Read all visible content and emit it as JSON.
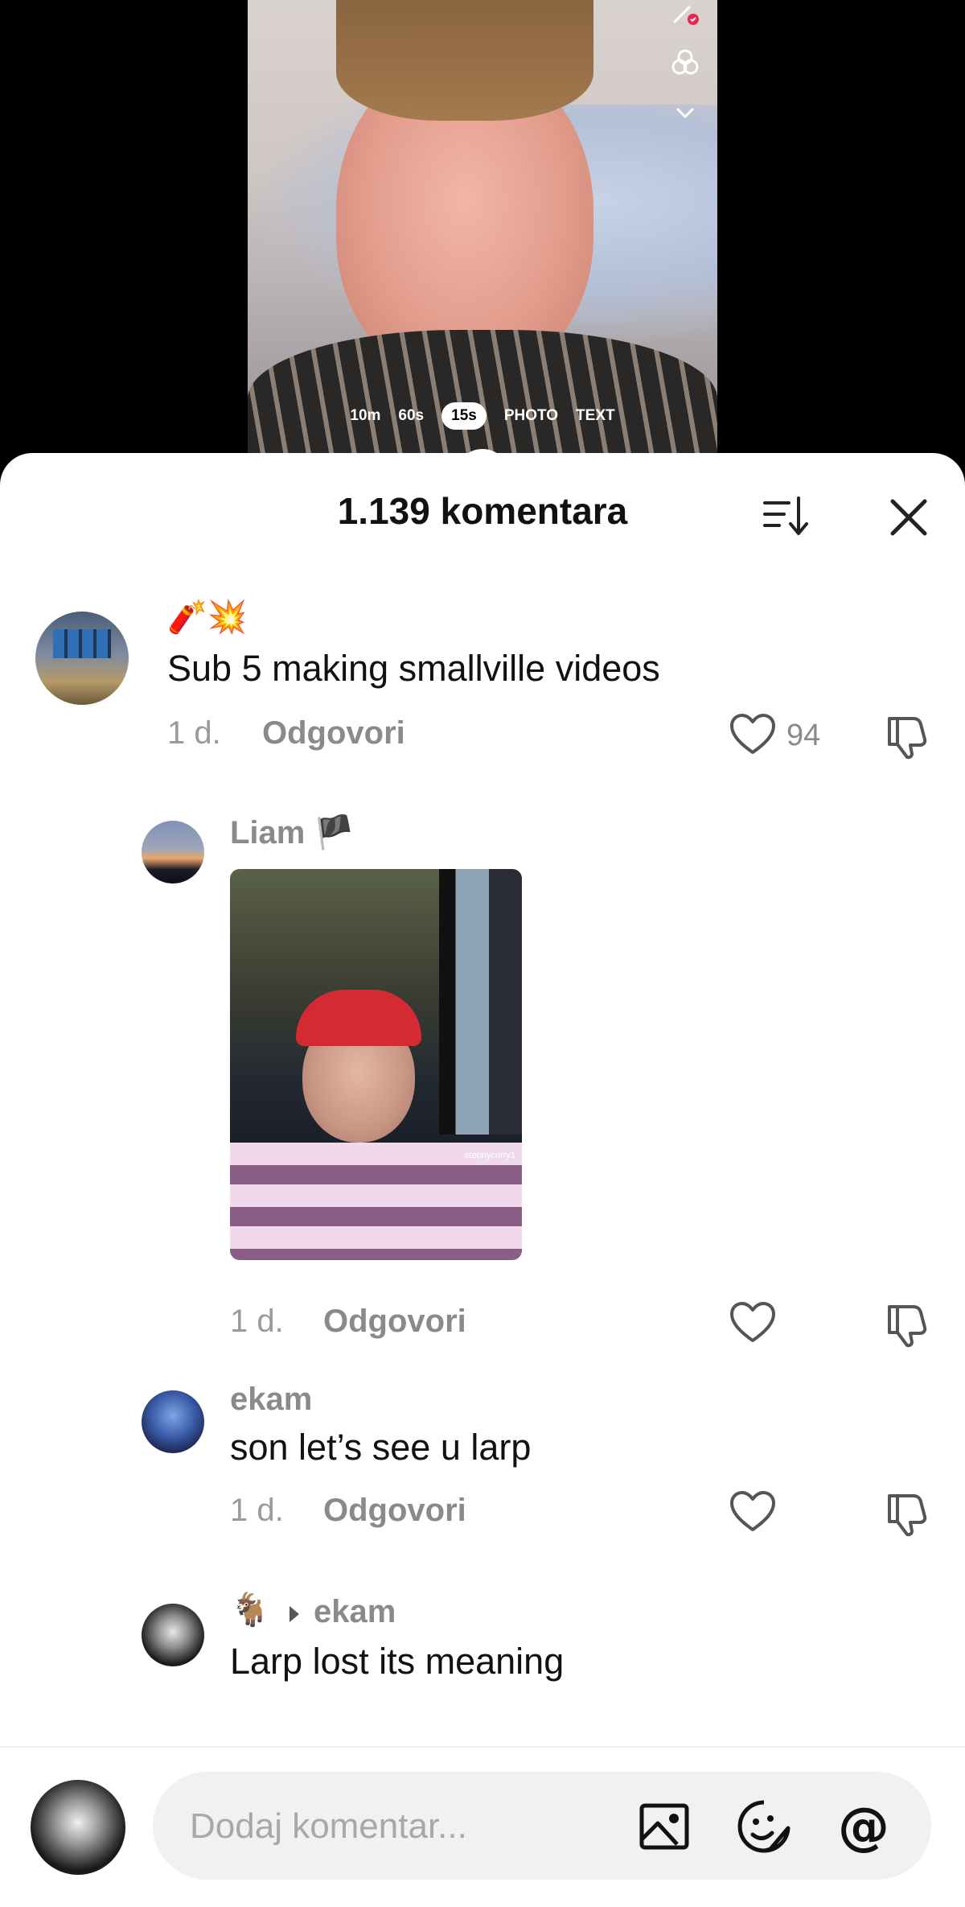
{
  "video": {
    "modes": [
      "10m",
      "60s",
      "15s",
      "PHOTO",
      "TEXT"
    ],
    "active_mode": "15s"
  },
  "comments_panel": {
    "title": "1.139 komentara",
    "sort_icon": "sort-icon",
    "close_icon": "close-icon"
  },
  "comments": [
    {
      "emoji": "🧨💥",
      "text": "Sub 5 making smallville videos",
      "time": "1 d.",
      "reply_label": "Odgovori",
      "likes": "94"
    },
    {
      "username": "Liam 🏴",
      "image_watermark": "stephycurry1",
      "time": "1 d.",
      "reply_label": "Odgovori"
    },
    {
      "username": "ekam",
      "text": "son let’s see u larp",
      "time": "1 d.",
      "reply_label": "Odgovori"
    },
    {
      "username_prefix": "🐐",
      "reply_to": "ekam",
      "text": "Larp lost its meaning"
    }
  ],
  "composer": {
    "placeholder": "Dodaj komentar...",
    "icons": [
      "image-icon",
      "sticker-icon",
      "mention-icon"
    ]
  }
}
